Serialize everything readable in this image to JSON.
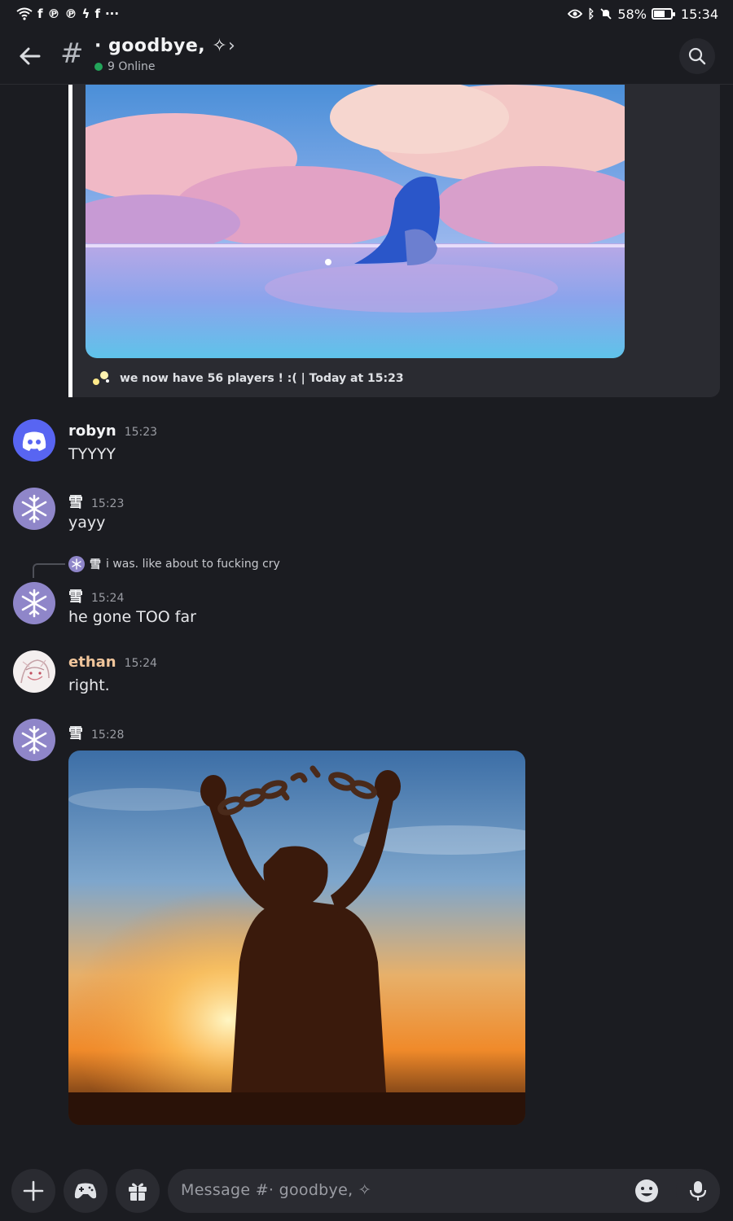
{
  "status_bar": {
    "left_icons": [
      "wifi-icon",
      "facebook-icon",
      "pinterest-icon",
      "pinterest-icon",
      "bolt-icon",
      "facebook-icon",
      "more-icon"
    ],
    "right_icons": [
      "eye-icon",
      "bluetooth-icon",
      "mute-icon",
      "battery-icon"
    ],
    "battery": "58%",
    "battery_level": 0.58,
    "time": "15:34"
  },
  "header": {
    "channel_name": "· goodbye, ✧",
    "chevron": "›",
    "online_text": "9 Online",
    "hash": "#"
  },
  "embed": {
    "footer_text": "we now have 56 players ! :( | Today at 15:23"
  },
  "messages": [
    {
      "author": "robyn",
      "time": "15:23",
      "text": "TYYYY",
      "avatar": "discord-logo"
    },
    {
      "author": "雪",
      "time": "15:23",
      "text": "yayy",
      "avatar": "snowflake"
    },
    {
      "author": "雪",
      "time": "15:24",
      "text": "he gone TOO far",
      "avatar": "snowflake",
      "reply": {
        "author": "雪",
        "text": "i was. like about to fucking cry"
      }
    },
    {
      "author": "ethan",
      "time": "15:24",
      "text": "right.",
      "avatar": "anime-sketch"
    },
    {
      "author": "雪",
      "time": "15:28",
      "text": "",
      "avatar": "snowflake",
      "attachment": "broken-chains-image"
    }
  ],
  "composer": {
    "placeholder": "Message #· goodbye, ✧"
  },
  "colors": {
    "background": "#1b1c21",
    "surface": "#2a2b31",
    "online": "#23a55a",
    "discord_blurple": "#5865f2",
    "ethan_name": "#f0c59b"
  }
}
